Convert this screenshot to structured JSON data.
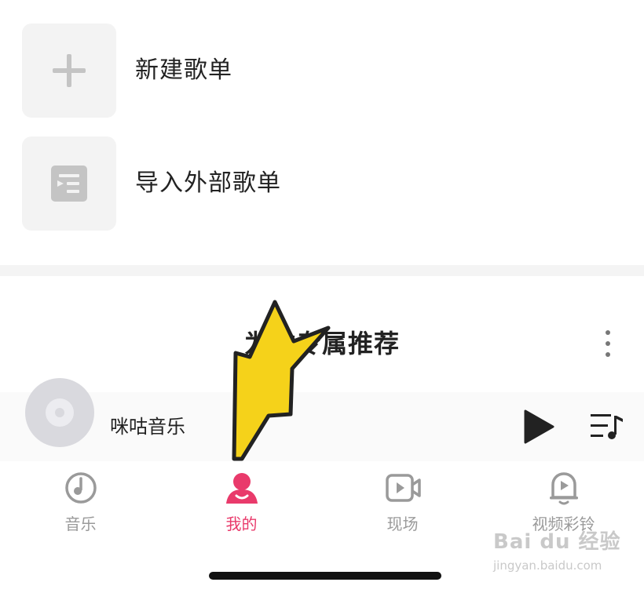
{
  "playlists": [
    {
      "label": "新建歌单",
      "icon": "plus-icon"
    },
    {
      "label": "导入外部歌单",
      "icon": "import-playlist-icon"
    }
  ],
  "recommend": {
    "title": "为你专属推荐",
    "more_icon": "more-vertical-icon"
  },
  "player": {
    "title": "咪咕音乐",
    "cover_icon": "disc-icon",
    "play_icon": "play-icon",
    "playlist_icon": "playlist-icon"
  },
  "tabs": [
    {
      "label": "音乐",
      "icon": "music-disc-icon",
      "active": false
    },
    {
      "label": "我的",
      "icon": "profile-icon",
      "active": true
    },
    {
      "label": "现场",
      "icon": "video-camera-icon",
      "active": false
    },
    {
      "label": "视频彩铃",
      "icon": "bell-play-icon",
      "active": false
    }
  ],
  "watermark": {
    "main": "Bai du 经验",
    "sub": "jingyan.baidu.com"
  },
  "colors": {
    "accent": "#e93a6b",
    "tab_inactive": "#9a9a9a",
    "arrow_fill": "#f5d21a",
    "arrow_outline": "#222222",
    "tile_bg": "#f3f3f3"
  }
}
